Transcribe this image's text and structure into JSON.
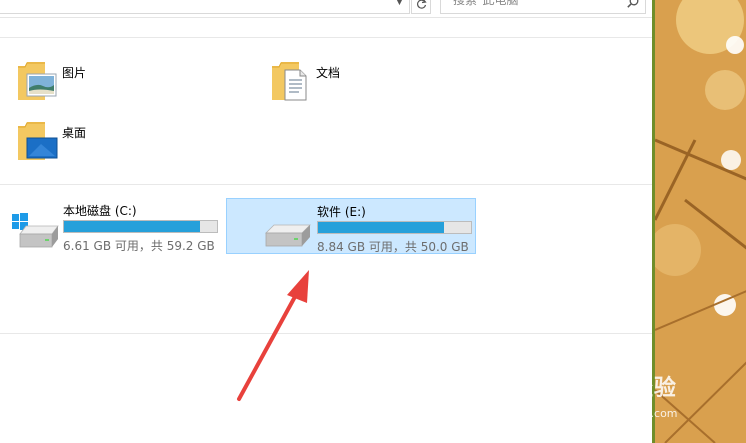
{
  "toolbar": {
    "dropdown_icon": "chevron-down-icon",
    "refresh_icon": "refresh-icon",
    "search_placeholder": "搜索\"此电脑\"",
    "search_icon": "search-icon"
  },
  "folders": [
    {
      "label": "图片",
      "icon": "pictures-folder-icon"
    },
    {
      "label": "文档",
      "icon": "documents-folder-icon"
    },
    {
      "label": "桌面",
      "icon": "desktop-folder-icon"
    }
  ],
  "drives": [
    {
      "label": "本地磁盘 (C:)",
      "info": "6.61 GB 可用，共 59.2 GB",
      "used_fraction": 0.888,
      "icon": "windows-drive-icon",
      "selected": false
    },
    {
      "label": "软件 (E:)",
      "info": "8.84 GB 可用，共 50.0 GB",
      "used_fraction": 0.823,
      "icon": "hard-drive-icon",
      "selected": true
    }
  ],
  "annotation": {
    "icon": "red-arrow-icon",
    "color": "#e8413c"
  },
  "watermark": {
    "brand": "Bai 经验",
    "site": "jingyan.baidu.com"
  },
  "colors": {
    "selection": "#cce8ff",
    "usage_bar": "#26a0da"
  }
}
